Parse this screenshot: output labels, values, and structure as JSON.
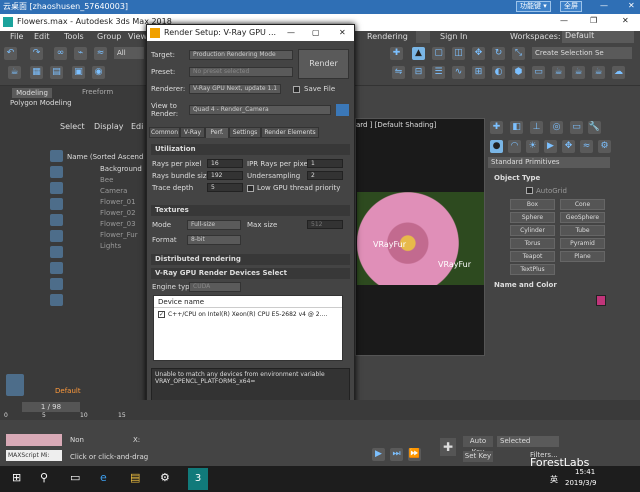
{
  "rdp": {
    "title": "云桌面 [zhaoshusen_57640003]",
    "fn_menu": "功能键 ▾",
    "fullscreen": "全屏"
  },
  "app": {
    "title": "Flowers.max - Autodesk 3ds Max 2018",
    "sign_in": "Sign In",
    "workspaces_label": "Workspaces:",
    "workspace": "Default",
    "rendering_menu": "Rendering"
  },
  "menus": [
    "File",
    "Edit",
    "Tools",
    "Group",
    "Views"
  ],
  "toolbar": {
    "all": "All",
    "create_selection": "Create Selection Se"
  },
  "ribbon": {
    "tab1": "Modeling",
    "tab2": "Freeform",
    "sub": "Polygon Modeling"
  },
  "scene_explorer": {
    "menus": [
      "Select",
      "Display",
      "Edi"
    ],
    "header": "Name (Sorted Ascend",
    "items": [
      "Background",
      "Bee",
      "Camera",
      "Flower_01",
      "Flower_02",
      "Flower_03",
      "Flower_Fur",
      "Lights"
    ],
    "layer": "Default"
  },
  "viewport": {
    "label": "ard ] [Default Shading]",
    "watermark1": "VRayFur",
    "watermark2": "VRayFur"
  },
  "command_panel": {
    "dropdown": "Standard Primitives",
    "object_type": "Object Type",
    "autogrid": "AutoGrid",
    "buttons": [
      "Box",
      "Cone",
      "Sphere",
      "GeoSphere",
      "Cylinder",
      "Tube",
      "Torus",
      "Pyramid",
      "Teapot",
      "Plane",
      "TextPlus"
    ],
    "name_color": "Name and Color",
    "color": "#c0357a"
  },
  "dialog": {
    "title": "Render Setup: V-Ray GPU ...",
    "target_label": "Target:",
    "target": "Production Rendering Mode",
    "preset_label": "Preset:",
    "preset": "No preset selected",
    "renderer_label": "Renderer:",
    "renderer": "V-Ray GPU Next, update 1.1",
    "save_file": "Save File",
    "view_label": "View to",
    "render_label": "Render:",
    "view": "Quad 4 - Render_Camera",
    "render_button": "Render",
    "tabs": [
      "Common",
      "V-Ray",
      "Perf.",
      "Settings",
      "Render Elements"
    ],
    "utilization": {
      "title": "Utilization",
      "rays_per_pixel_label": "Rays per pixel",
      "rays_per_pixel": "16",
      "ipr_rays_label": "IPR Rays per pixel",
      "ipr_rays": "1",
      "bundle_label": "Rays bundle size",
      "bundle": "192",
      "undersampling_label": "Undersampling",
      "undersampling": "2",
      "trace_label": "Trace depth",
      "trace": "5",
      "low_gpu": "Low GPU thread priority"
    },
    "textures": {
      "title": "Textures",
      "mode_label": "Mode",
      "mode": "Full-size",
      "maxsize_label": "Max size",
      "maxsize": "512",
      "format_label": "Format",
      "format": "8-bit"
    },
    "distributed": {
      "title": "Distributed rendering"
    },
    "devices": {
      "title": "V-Ray GPU Render Devices Select",
      "engine_label": "Engine type",
      "engine": "CUDA",
      "col": "Device name",
      "device": "C++/CPU on Intel(R) Xeon(R) CPU E5-2682 v4 @ 2...."
    },
    "message": "Unable to match any devices from environment variable VRAY_OPENCL_PLATFORMS_x64="
  },
  "timeline": {
    "frame": "1 / 98",
    "ticks": [
      "0",
      "5",
      "10",
      "15"
    ]
  },
  "status": {
    "none": "Non",
    "maxscript": "MAXScript Mi:",
    "hint": "Click or click-and-drag",
    "x": "X:",
    "auto_key": "Auto Key",
    "set_key": "Set Key",
    "selected": "Selected",
    "filters": "Filters..."
  },
  "taskbar": {
    "time": "15:41",
    "date": "2019/3/9",
    "lang": "英",
    "watermark": "ForestLabs"
  }
}
